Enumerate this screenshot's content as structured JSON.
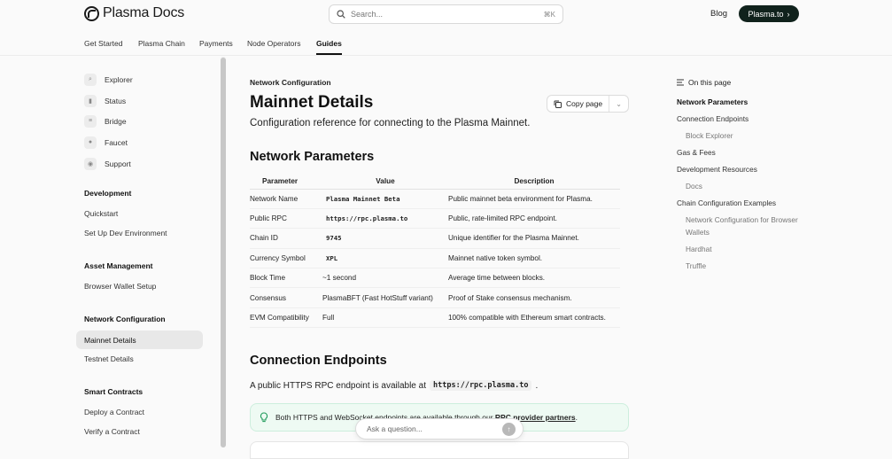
{
  "header": {
    "logo_text": "Plasma Docs",
    "search_placeholder": "Search...",
    "search_shortcut": "⌘K",
    "blog_label": "Blog",
    "cta_label": "Plasma.to"
  },
  "tabs": [
    {
      "label": "Get Started"
    },
    {
      "label": "Plasma Chain"
    },
    {
      "label": "Payments"
    },
    {
      "label": "Node Operators"
    },
    {
      "label": "Guides",
      "active": true
    }
  ],
  "sidebar": {
    "top_items": [
      {
        "label": "Explorer",
        "icon": "search-icon"
      },
      {
        "label": "Status",
        "icon": "bar-chart-icon"
      },
      {
        "label": "Bridge",
        "icon": "bridge-icon"
      },
      {
        "label": "Faucet",
        "icon": "droplet-icon"
      },
      {
        "label": "Support",
        "icon": "discord-icon"
      }
    ],
    "sections": [
      {
        "heading": "Development",
        "items": [
          "Quickstart",
          "Set Up Dev Environment"
        ]
      },
      {
        "heading": "Asset Management",
        "items": [
          "Browser Wallet Setup"
        ]
      },
      {
        "heading": "Network Configuration",
        "items": [
          "Mainnet Details",
          "Testnet Details"
        ]
      },
      {
        "heading": "Smart Contracts",
        "items": [
          "Deploy a Contract",
          "Verify a Contract"
        ]
      }
    ],
    "active_item": "Mainnet Details"
  },
  "main": {
    "eyebrow": "Network Configuration",
    "title": "Mainnet Details",
    "copy_label": "Copy page",
    "lead": "Configuration reference for connecting to the Plasma Mainnet.",
    "h2_params": "Network Parameters",
    "table": {
      "headers": [
        "Parameter",
        "Value",
        "Description"
      ],
      "rows": [
        [
          "Network Name",
          "Plasma Mainnet Beta",
          "Public mainnet beta environment for Plasma."
        ],
        [
          "Public RPC",
          "https://rpc.plasma.to",
          "Public, rate-limited RPC endpoint."
        ],
        [
          "Chain ID",
          "9745",
          "Unique identifier for the Plasma Mainnet."
        ],
        [
          "Currency Symbol",
          "XPL",
          "Mainnet native token symbol."
        ],
        [
          "Block Time",
          "~1 second",
          "Average time between blocks."
        ],
        [
          "Consensus",
          "PlasmaBFT (Fast HotStuff variant)",
          "Proof of Stake consensus mechanism."
        ],
        [
          "EVM Compatibility",
          "Full",
          "100% compatible with Ethereum smart contracts."
        ]
      ]
    },
    "h2_endpoints": "Connection Endpoints",
    "endpoint_text_before": "A public HTTPS RPC endpoint is available at",
    "endpoint_code": "https://rpc.plasma.to",
    "endpoint_text_after": ".",
    "callout_text": "Both HTTPS and WebSocket endpoints are available through our",
    "callout_link": "RPC provider partners",
    "callout_end": "."
  },
  "ask": {
    "placeholder": "Ask a question..."
  },
  "toc": {
    "heading": "On this page",
    "items": [
      {
        "label": "Network Parameters",
        "level": 1,
        "active": true
      },
      {
        "label": "Connection Endpoints",
        "level": 1
      },
      {
        "label": "Block Explorer",
        "level": 2
      },
      {
        "label": "Gas & Fees",
        "level": 1
      },
      {
        "label": "Development Resources",
        "level": 1
      },
      {
        "label": "Docs",
        "level": 2
      },
      {
        "label": "Chain Configuration Examples",
        "level": 1
      },
      {
        "label": "Network Configuration for Browser Wallets",
        "level": 2
      },
      {
        "label": "Hardhat",
        "level": 2
      },
      {
        "label": "Truffle",
        "level": 2
      }
    ]
  }
}
